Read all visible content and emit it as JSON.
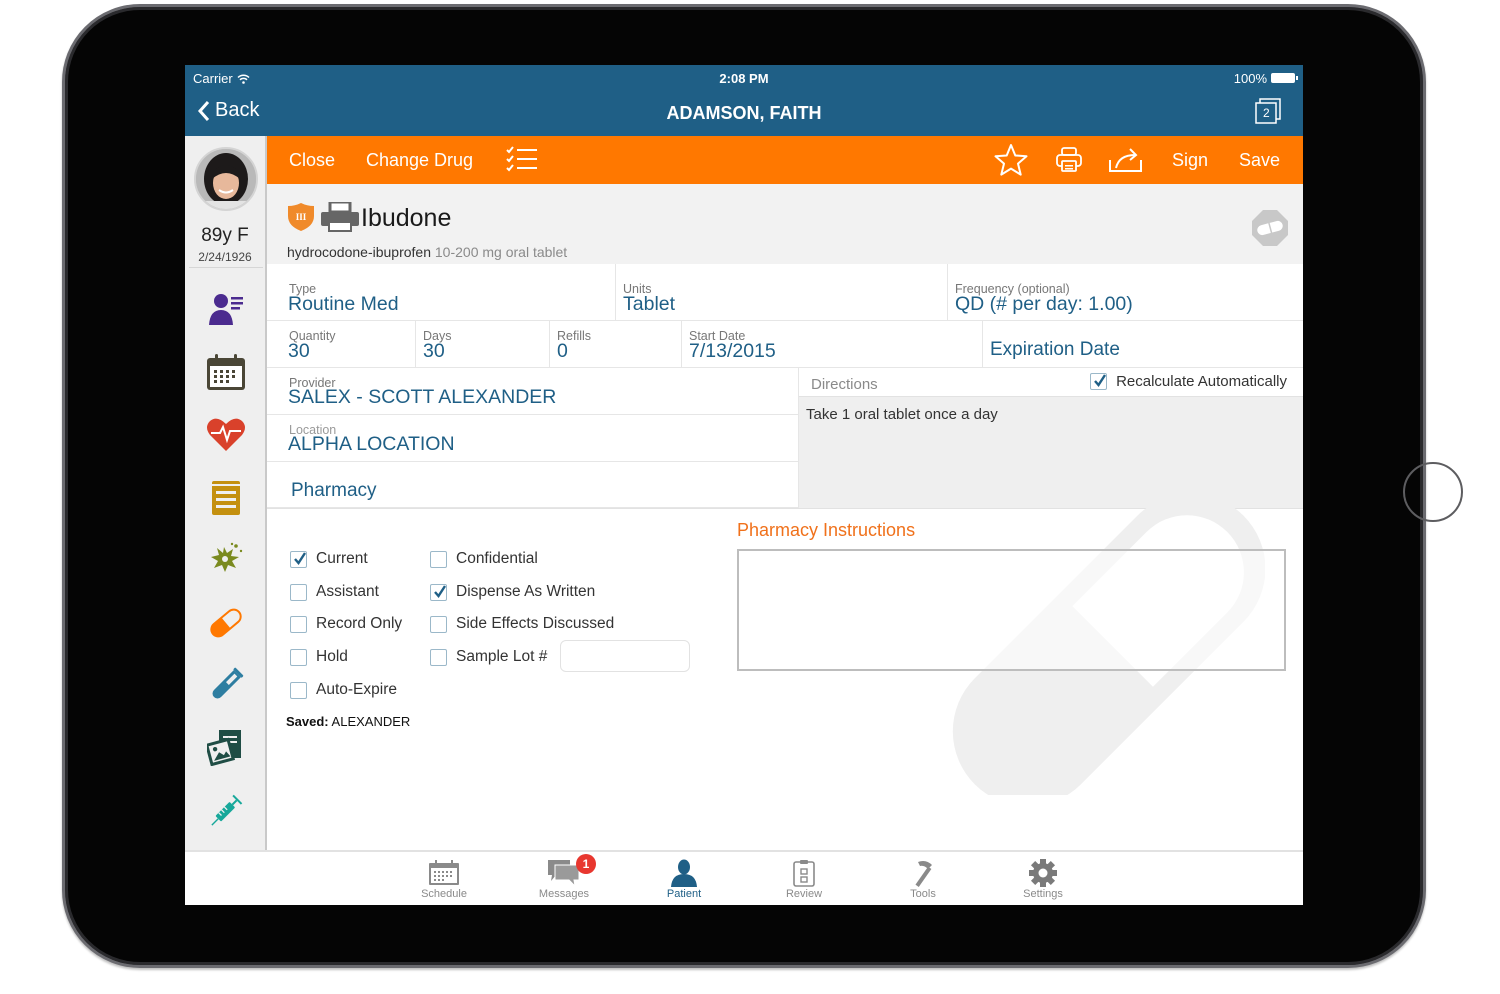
{
  "status_bar": {
    "carrier": "Carrier",
    "time": "2:08 PM",
    "battery": "100%"
  },
  "nav": {
    "back_label": "Back",
    "title": "ADAMSON, FAITH",
    "open_pages_count": "2"
  },
  "patient": {
    "age_sex": "89y F",
    "dob": "2/24/1926"
  },
  "sidebar": {
    "items": [
      {
        "name": "demographics",
        "icon": "person-list-icon",
        "color": "#4b2b8f"
      },
      {
        "name": "appointments",
        "icon": "calendar-icon",
        "color": "#4a4636"
      },
      {
        "name": "vitals",
        "icon": "heart-pulse-icon",
        "color": "#d9412b"
      },
      {
        "name": "notes",
        "icon": "document-lines-icon",
        "color": "#c4900f"
      },
      {
        "name": "allergies",
        "icon": "allergy-splat-icon",
        "color": "#7a8a1f"
      },
      {
        "name": "medications",
        "icon": "pill-icon",
        "color": "#ff7800"
      },
      {
        "name": "labs",
        "icon": "test-tube-icon",
        "color": "#2e7ea1"
      },
      {
        "name": "images",
        "icon": "image-document-icon",
        "color": "#1f4d45"
      },
      {
        "name": "immunizations",
        "icon": "syringe-icon",
        "color": "#17a89a"
      }
    ]
  },
  "toolbar": {
    "close_label": "Close",
    "change_drug_label": "Change Drug",
    "checklist_icon": "checklist-icon",
    "favorite_icon": "star-icon",
    "print_icon": "printer-icon",
    "share_icon": "share-icon",
    "sign_label": "Sign",
    "save_label": "Save",
    "color": "#ff7800"
  },
  "drug": {
    "schedule": "III",
    "name": "Ibudone",
    "generic": "hydrocodone-ibuprofen",
    "strength": "10-200 mg oral tablet"
  },
  "fields": {
    "type": {
      "label": "Type",
      "value": "Routine Med"
    },
    "units": {
      "label": "Units",
      "value": "Tablet"
    },
    "frequency": {
      "label": "Frequency (optional)",
      "value": "QD (# per day: 1.00)"
    },
    "quantity": {
      "label": "Quantity",
      "value": "30"
    },
    "days": {
      "label": "Days",
      "value": "30"
    },
    "refills": {
      "label": "Refills",
      "value": "0"
    },
    "start_date": {
      "label": "Start Date",
      "value": "7/13/2015"
    },
    "expiration_date": {
      "placeholder": "Expiration Date"
    },
    "provider": {
      "label": "Provider",
      "value": "SALEX - SCOTT ALEXANDER"
    },
    "location": {
      "label": "Location",
      "value": "ALPHA LOCATION"
    },
    "pharmacy": {
      "placeholder": "Pharmacy"
    }
  },
  "directions": {
    "label": "Directions",
    "recalculate_label": "Recalculate Automatically",
    "recalculate_checked": true,
    "text": "Take 1 oral tablet once a day"
  },
  "options": {
    "left": [
      {
        "label": "Current",
        "checked": true
      },
      {
        "label": "Assistant",
        "checked": false
      },
      {
        "label": "Record Only",
        "checked": false
      },
      {
        "label": "Hold",
        "checked": false
      },
      {
        "label": "Auto-Expire",
        "checked": false
      }
    ],
    "right": [
      {
        "label": "Confidential",
        "checked": false
      },
      {
        "label": "Dispense As Written",
        "checked": true
      },
      {
        "label": "Side Effects Discussed",
        "checked": false
      },
      {
        "label": "Sample Lot #",
        "checked": false
      }
    ],
    "sample_lot_value": ""
  },
  "saved": {
    "prefix": "Saved:",
    "by": "ALEXANDER"
  },
  "pharmacy_instructions": {
    "title": "Pharmacy Instructions",
    "value": ""
  },
  "tabs": [
    {
      "label": "Schedule",
      "icon": "calendar-icon",
      "active": false
    },
    {
      "label": "Messages",
      "icon": "chat-bubbles-icon",
      "active": false,
      "badge": "1"
    },
    {
      "label": "Patient",
      "icon": "person-icon",
      "active": true
    },
    {
      "label": "Review",
      "icon": "clipboard-icon",
      "active": false
    },
    {
      "label": "Tools",
      "icon": "hammer-icon",
      "active": false
    },
    {
      "label": "Settings",
      "icon": "gear-icon",
      "active": false
    }
  ],
  "colors": {
    "header_blue": "#1f5f86",
    "accent_orange": "#ff7800",
    "instruction_orange": "#f0711b",
    "badge_red": "#e8372f"
  }
}
